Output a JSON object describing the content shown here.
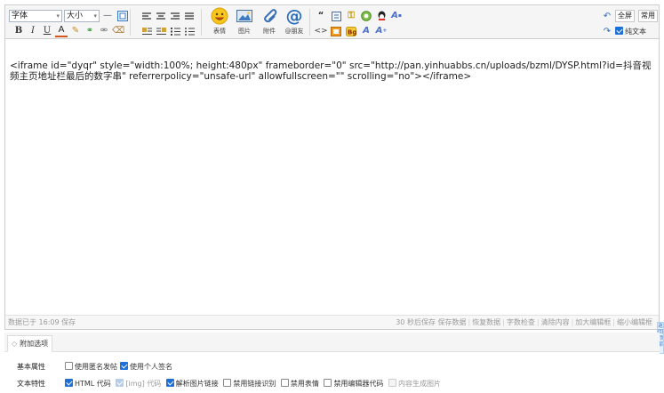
{
  "toolbar": {
    "font_select": "字体",
    "size_select": "大小",
    "big_buttons": {
      "emoji": "表情",
      "image": "图片",
      "attach": "附件",
      "at": "@朋友"
    },
    "right": {
      "fullscreen": "全屏",
      "common": "常用",
      "plaintext_label": "纯文本",
      "plaintext_checked": true
    }
  },
  "content": {
    "text": "<iframe id=\"dyqr\" style=\"width:100%; height:480px\" frameborder=\"0\" src=\"http://pan.yinhuabbs.cn/uploads/bzml/DYSP.html?id=抖音视频主页地址栏最后的数字串\" referrerpolicy=\"unsafe-url\" allowfullscreen=\"\" scrolling=\"no\"></iframe>"
  },
  "status": {
    "saved": "数据已于 16:09 保存",
    "links": [
      "30 秒后保存 保存数据",
      "恢复数据",
      "字数检查",
      "清除内容",
      "加大编辑框",
      "缩小编辑框"
    ]
  },
  "side_button": "返回顶部",
  "tab": {
    "label": "附加选项"
  },
  "options": {
    "basic": {
      "heading": "基本属性",
      "items": [
        {
          "label": "使用匿名发帖",
          "checked": false
        },
        {
          "label": "使用个人签名",
          "checked": true
        }
      ]
    },
    "text": {
      "heading": "文本特性",
      "items": [
        {
          "label": "HTML 代码",
          "checked": true,
          "disabled": false
        },
        {
          "label": "[img] 代码",
          "checked": true,
          "disabled": true
        },
        {
          "label": "解析图片链接",
          "checked": true,
          "disabled": false
        },
        {
          "label": "禁用链接识别",
          "checked": false,
          "disabled": false
        },
        {
          "label": "禁用表情",
          "checked": false,
          "disabled": false
        },
        {
          "label": "禁用编辑器代码",
          "checked": false,
          "disabled": false
        },
        {
          "label": "内容生成图片",
          "checked": false,
          "disabled": true
        }
      ]
    }
  },
  "colors": {
    "accent": "#1e6fd8",
    "toolbar_bg": "#f5f5f5",
    "border": "#cdcdcd"
  }
}
